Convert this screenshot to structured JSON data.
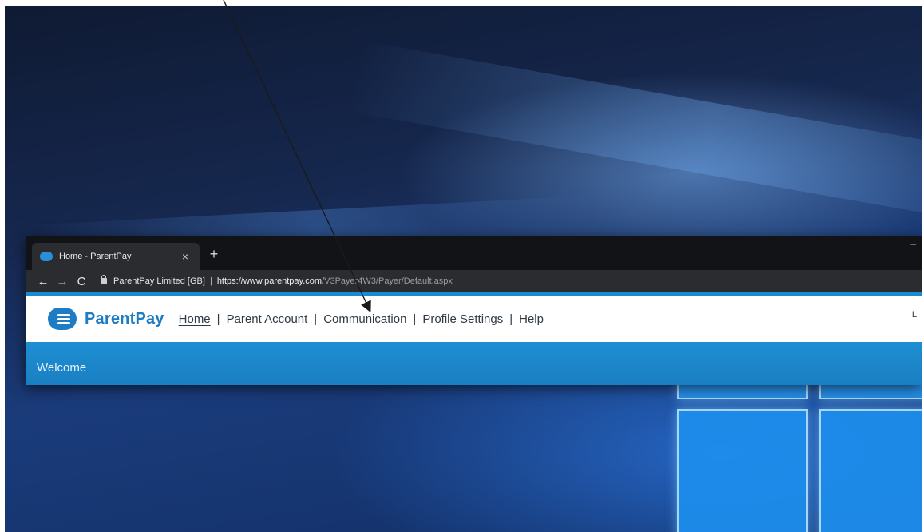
{
  "browser": {
    "tab": {
      "title": "Home - ParentPay",
      "close_label": "×"
    },
    "new_tab_label": "+",
    "nav": {
      "back": "←",
      "forward": "→",
      "reload": "C"
    },
    "address": {
      "org": "ParentPay Limited [GB]",
      "separator": "|",
      "url_base": "https://www.parentpay.com",
      "url_path": "/V3Payer4W3/Payer/Default.aspx"
    }
  },
  "site": {
    "brand": "ParentPay",
    "nav": [
      "Home",
      "Parent Account",
      "Communication",
      "Profile Settings",
      "Help"
    ],
    "divider": "|",
    "corner_text": "L",
    "welcome": "Welcome"
  },
  "colors": {
    "brand": "#1d7cc4",
    "welcome_bar": "#1e8fd3",
    "annotation_arrow": "#1a1a1a"
  }
}
